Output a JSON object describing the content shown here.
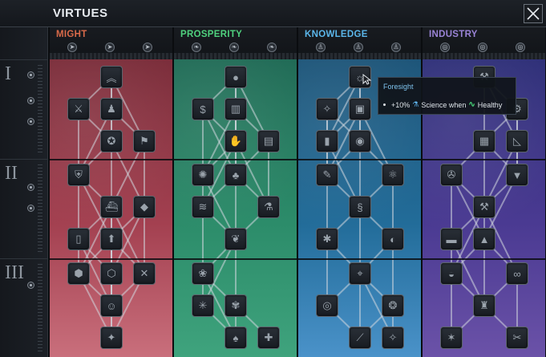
{
  "window": {
    "title": "VIRTUES"
  },
  "tiers": [
    {
      "label": "I"
    },
    {
      "label": "II"
    },
    {
      "label": "III"
    }
  ],
  "columns": [
    {
      "name": "MIGHT",
      "color": "#d96a4a",
      "background": [
        "#7a2c39",
        "#a34050",
        "#c96f7c"
      ],
      "category_icons": [
        "arrow-icon",
        "arrow-icon",
        "arrow-icon"
      ],
      "nodes": [
        {
          "icon": "chevron-rank-icon",
          "row": 0,
          "col": 1
        },
        {
          "icon": "sword-icon",
          "row": 1,
          "col": 0
        },
        {
          "icon": "soldier-icon",
          "row": 1,
          "col": 1
        },
        {
          "icon": "medal-icon",
          "row": 2,
          "col": 1
        },
        {
          "icon": "flag-icon",
          "row": 2,
          "col": 2
        },
        {
          "icon": "shield-icon",
          "row": 3,
          "col": 0
        },
        {
          "icon": "ship-icon",
          "row": 4,
          "col": 1
        },
        {
          "icon": "gem-icon",
          "row": 4,
          "col": 2
        },
        {
          "icon": "pillar-icon",
          "row": 5,
          "col": 0
        },
        {
          "icon": "arrow-up-icon",
          "row": 5,
          "col": 1
        },
        {
          "icon": "tank-icon",
          "row": 6,
          "col": 0
        },
        {
          "icon": "hexagon-icon",
          "row": 6,
          "col": 1
        },
        {
          "icon": "crossed-swords-icon",
          "row": 6,
          "col": 2
        },
        {
          "icon": "pilot-icon",
          "row": 7,
          "col": 1
        },
        {
          "icon": "fire-icon",
          "row": 8,
          "col": 1
        }
      ]
    },
    {
      "name": "PROSPERITY",
      "color": "#4fd17e",
      "background": [
        "#1f6a55",
        "#2c8c6a",
        "#3fa37d"
      ],
      "category_icons": [
        "leaf-icon",
        "leaf-icon",
        "leaf-icon"
      ],
      "nodes": [
        {
          "icon": "apple-icon",
          "row": 0,
          "col": 1
        },
        {
          "icon": "dollar-icon",
          "row": 1,
          "col": 0
        },
        {
          "icon": "chart-icon",
          "row": 1,
          "col": 1
        },
        {
          "icon": "hand-icon",
          "row": 2,
          "col": 1
        },
        {
          "icon": "book-icon",
          "row": 2,
          "col": 2
        },
        {
          "icon": "virus-icon",
          "row": 3,
          "col": 0
        },
        {
          "icon": "plant-icon",
          "row": 3,
          "col": 1
        },
        {
          "icon": "stack-icon",
          "row": 4,
          "col": 0
        },
        {
          "icon": "flask-icon",
          "row": 4,
          "col": 2
        },
        {
          "icon": "brain-icon",
          "row": 5,
          "col": 1
        },
        {
          "icon": "lotus-icon",
          "row": 6,
          "col": 0
        },
        {
          "icon": "star-burst-icon",
          "row": 7,
          "col": 0
        },
        {
          "icon": "wheat-icon",
          "row": 7,
          "col": 1
        },
        {
          "icon": "tree-icon",
          "row": 8,
          "col": 1
        },
        {
          "icon": "cross-icon",
          "row": 8,
          "col": 2
        }
      ]
    },
    {
      "name": "KNOWLEDGE",
      "color": "#5bb6ea",
      "background": [
        "#1c5478",
        "#226c99",
        "#4a92c9"
      ],
      "category_icons": [
        "person-icon",
        "person-icon",
        "person-icon"
      ],
      "nodes": [
        {
          "icon": "lightbulb-icon",
          "row": 0,
          "col": 1
        },
        {
          "icon": "compass-icon",
          "row": 1,
          "col": 0
        },
        {
          "icon": "open-book-icon",
          "row": 1,
          "col": 1
        },
        {
          "icon": "tube-icon",
          "row": 2,
          "col": 0
        },
        {
          "icon": "bulb-idea-icon",
          "row": 2,
          "col": 1
        },
        {
          "icon": "pen-icon",
          "row": 3,
          "col": 0
        },
        {
          "icon": "atom-icon",
          "row": 3,
          "col": 2
        },
        {
          "icon": "dna-icon",
          "row": 4,
          "col": 1
        },
        {
          "icon": "bug-icon",
          "row": 5,
          "col": 0
        },
        {
          "icon": "planet-icon",
          "row": 5,
          "col": 2
        },
        {
          "icon": "microscope-icon",
          "row": 6,
          "col": 1
        },
        {
          "icon": "eye-icon",
          "row": 7,
          "col": 0
        },
        {
          "icon": "brain-scan-icon",
          "row": 7,
          "col": 2
        },
        {
          "icon": "telescope-icon",
          "row": 8,
          "col": 1
        },
        {
          "icon": "satellite-icon",
          "row": 8,
          "col": 2
        }
      ]
    },
    {
      "name": "INDUSTRY",
      "color": "#9a83d6",
      "background": [
        "#2e2f78",
        "#4a3a92",
        "#6b52a8"
      ],
      "category_icons": [
        "eye-icon",
        "eye-icon",
        "eye-icon"
      ],
      "nodes": [
        {
          "icon": "wrench-icon",
          "row": 0,
          "col": 1
        },
        {
          "icon": "gear-icon",
          "row": 1,
          "col": 2
        },
        {
          "icon": "factory-icon",
          "row": 2,
          "col": 1
        },
        {
          "icon": "set-square-icon",
          "row": 2,
          "col": 2
        },
        {
          "icon": "cog-arrows-icon",
          "row": 3,
          "col": 0
        },
        {
          "icon": "drill-icon",
          "row": 3,
          "col": 2
        },
        {
          "icon": "hammer-icon",
          "row": 4,
          "col": 1
        },
        {
          "icon": "anvil-icon",
          "row": 5,
          "col": 0
        },
        {
          "icon": "pyramid-icon",
          "row": 5,
          "col": 1
        },
        {
          "icon": "helmet-icon",
          "row": 6,
          "col": 0
        },
        {
          "icon": "chain-icon",
          "row": 6,
          "col": 2
        },
        {
          "icon": "tower-icon",
          "row": 7,
          "col": 1
        },
        {
          "icon": "mine-icon",
          "row": 8,
          "col": 0
        },
        {
          "icon": "tools-icon",
          "row": 8,
          "col": 2
        }
      ]
    }
  ],
  "tooltip": {
    "title": "Foresight",
    "bonus": "+10%",
    "science_text": "Science when",
    "health_text": "Healthy"
  }
}
